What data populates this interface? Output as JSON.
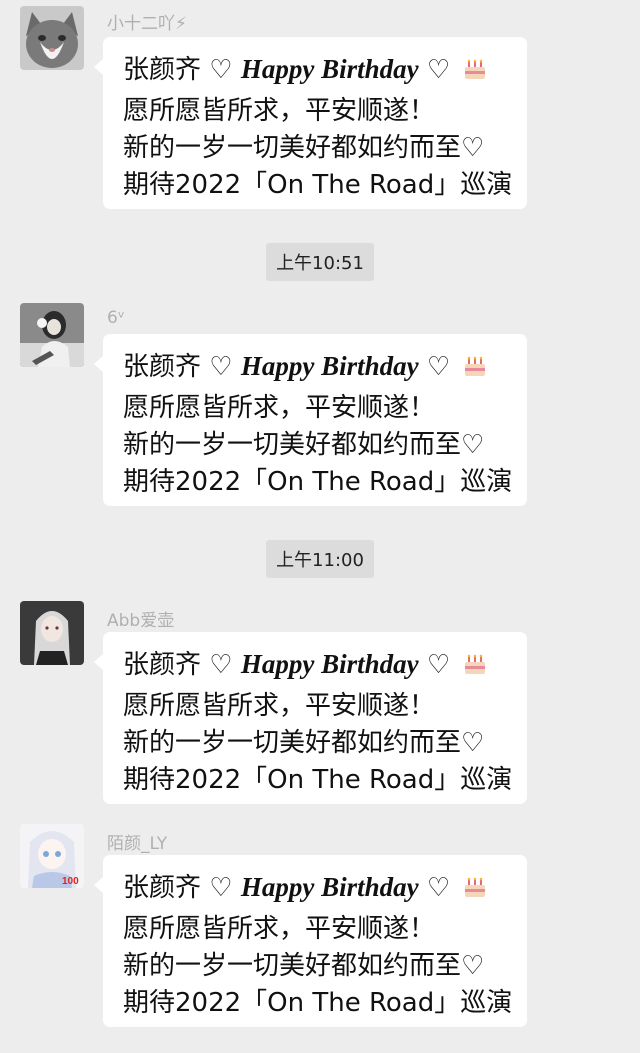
{
  "messages": [
    {
      "sender": "小十二吖⚡",
      "lines": [
        "张颜齐 ♡ ",
        "Happy Birthday",
        " ♡ ",
        "愿所愿皆所求，平安顺遂！",
        "新的一岁一切美好都如约而至♡",
        "期待2022「On The Road」巡演"
      ],
      "avatar": "cat-avatar"
    },
    {
      "sender": "6ᵛ",
      "lines": [
        "张颜齐 ♡ ",
        "Happy Birthday",
        " ♡ ",
        "愿所愿皆所求，平安顺遂！",
        "新的一岁一切美好都如约而至♡",
        "期待2022「On The Road」巡演"
      ],
      "avatar": "girl-headphones-avatar"
    },
    {
      "sender": "Abb爱壶",
      "lines": [
        "张颜齐 ♡ ",
        "Happy Birthday",
        " ♡ ",
        "愿所愿皆所求，平安顺遂！",
        "新的一岁一切美好都如约而至♡",
        "期待2022「On The Road」巡演"
      ],
      "avatar": "anime-silver-hair-avatar"
    },
    {
      "sender": "陌颜_LY",
      "lines": [
        "张颜齐 ♡ ",
        "Happy Birthday",
        " ♡ ",
        "愿所愿皆所求，平安顺遂！",
        "新的一岁一切美好都如约而至♡",
        "期待2022「On The Road」巡演"
      ],
      "avatar": "anime-white-hair-avatar",
      "avatar_badge": "100"
    }
  ],
  "timestamps": [
    "上午10:51",
    "上午11:00"
  ]
}
